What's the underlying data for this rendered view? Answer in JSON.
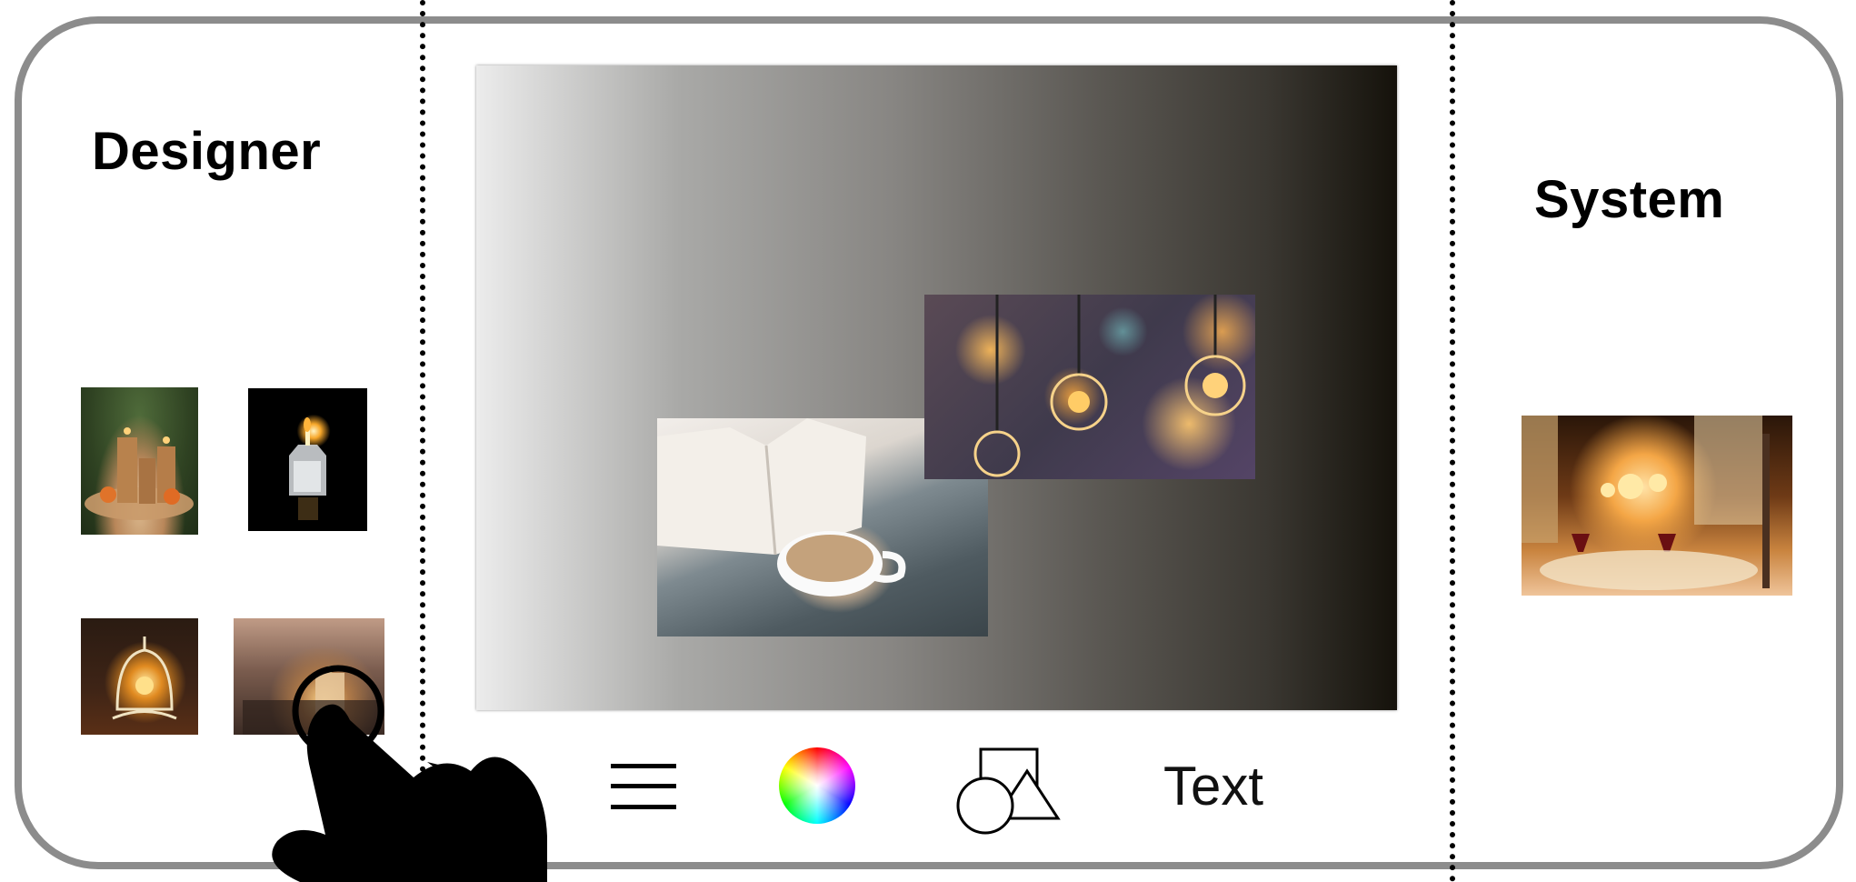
{
  "labels": {
    "designer": "Designer",
    "system": "System"
  },
  "toolbar": {
    "text_tool": "Text"
  },
  "icons": {
    "menu": "menu-icon",
    "color": "color-wheel-icon",
    "shapes": "shapes-icon",
    "hand": "hand-pointer-icon"
  },
  "colors": {
    "frame_border": "#8c8c8c",
    "divider": "#000000"
  }
}
